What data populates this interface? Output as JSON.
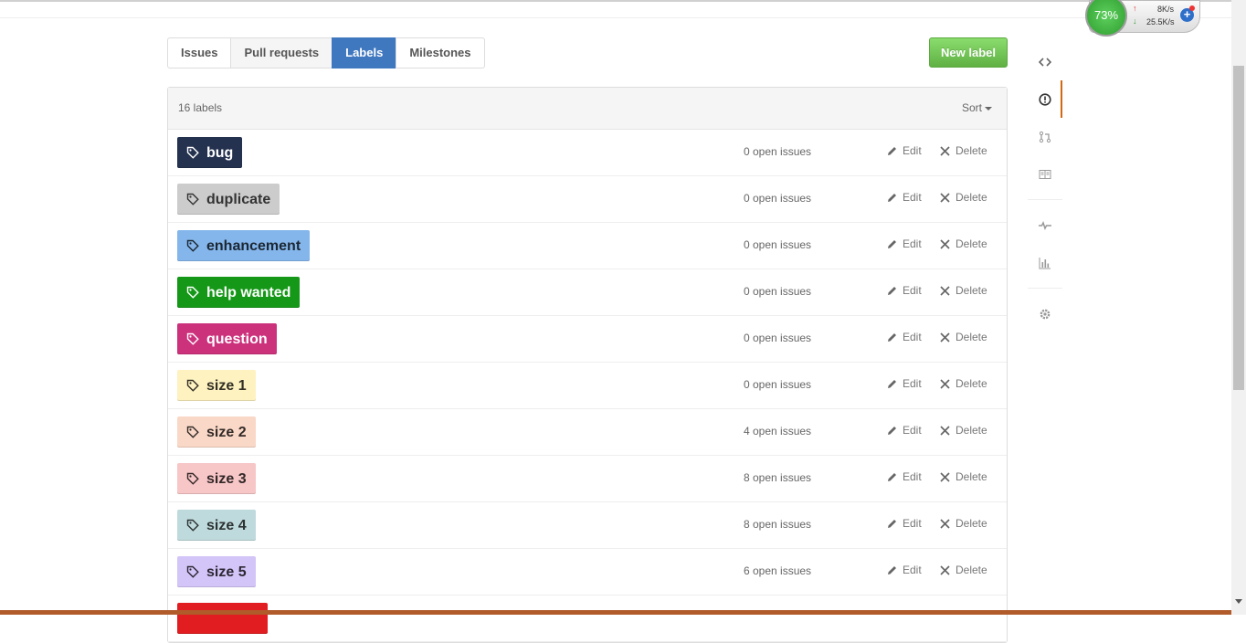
{
  "tabs": [
    {
      "label": "Issues"
    },
    {
      "label": "Pull requests"
    },
    {
      "label": "Labels"
    },
    {
      "label": "Milestones"
    }
  ],
  "new_label_button": "New label",
  "header": {
    "count": "16 labels",
    "sort": "Sort"
  },
  "actions": {
    "edit": "Edit",
    "delete": "Delete"
  },
  "labels": [
    {
      "name": "bug",
      "issues": "0 open issues",
      "bg": "#24314f",
      "fg": "#ffffff"
    },
    {
      "name": "duplicate",
      "issues": "0 open issues",
      "bg": "#cccccc",
      "fg": "#333333"
    },
    {
      "name": "enhancement",
      "issues": "0 open issues",
      "bg": "#84b6eb",
      "fg": "#1c2733"
    },
    {
      "name": "help wanted",
      "issues": "0 open issues",
      "bg": "#159818",
      "fg": "#ffffff"
    },
    {
      "name": "question",
      "issues": "0 open issues",
      "bg": "#cc317c",
      "fg": "#ffffff"
    },
    {
      "name": "size 1",
      "issues": "0 open issues",
      "bg": "#fef2c0",
      "fg": "#333026"
    },
    {
      "name": "size 2",
      "issues": "4 open issues",
      "bg": "#fad8c7",
      "fg": "#332b28"
    },
    {
      "name": "size 3",
      "issues": "8 open issues",
      "bg": "#f7c6c7",
      "fg": "#332828"
    },
    {
      "name": "size 4",
      "issues": "8 open issues",
      "bg": "#bfdadc",
      "fg": "#2c3233"
    },
    {
      "name": "size 5",
      "issues": "6 open issues",
      "bg": "#d4c5f9",
      "fg": "#2c2833"
    },
    {
      "name": "",
      "issues": "",
      "bg": "#e11d21",
      "fg": "#ffffff"
    }
  ],
  "widget": {
    "percent": "73%",
    "up": "8K/s",
    "down": "25.5K/s"
  },
  "colors": {
    "tab_active": "#4078c0",
    "new_label": "#60b044",
    "sidebar_selected": "#d26911"
  }
}
